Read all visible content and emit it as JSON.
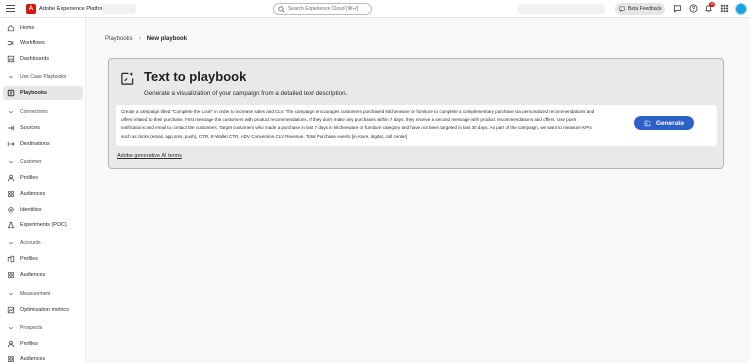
{
  "app": {
    "title": "Adobe Experience Platform",
    "logo_letter": "A"
  },
  "search": {
    "placeholder": "Search Experience Cloud [⌘+/]"
  },
  "header": {
    "beta_feedback": "Beta Feedback",
    "notification_count": "10"
  },
  "sidebar": {
    "home": "Home",
    "workflows": "Workflows",
    "dashboards": "Dashboards",
    "use_case_playbooks": "Use Case Playbooks",
    "playbooks": "Playbooks",
    "connections": "Connections",
    "sources": "Sources",
    "destinations": "Destinations",
    "customer": "Customer",
    "customer_profiles": "Profiles",
    "customer_audiences": "Audiences",
    "identities": "Identities",
    "experiments": "Experiments (POC)",
    "accounts": "Accounts",
    "accounts_profiles": "Profiles",
    "accounts_audiences": "Audiences",
    "measurement": "Measurement",
    "optimization_metrics": "Optimization metrics",
    "prospects": "Prospects",
    "prospects_profiles": "Profiles",
    "prospects_audiences": "Audiences"
  },
  "breadcrumb": {
    "parent": "Playbooks",
    "separator": "›",
    "current": "New playbook"
  },
  "panel": {
    "title": "Text to playbook",
    "subtitle": "Generate a visualization of your campaign from a detailed text description.",
    "prompt_text": "Create a campaign titled \"Complete the Look\" in order to increase sales and CLV. The campaign encourages customers purchased kitchenware or furniture to complete a complementary purchase via personalized recommendations and offers related to their purchase. First message the customers with product recommendations. If they don't make any purchases within 7 days, they receive a second message with product recommendations and offers. Use push notifications and email to contact the customers. Target customers who made a purchase in last 7 days in kitchenware or furniture category and have not been targeted in last 30 days. As part of the campaign, we want to measure KPIs such as clicks (email, app,sms, push), CTR, E-Wallet CTR, ADV Conversion,CLV Revenue, Total Purchase events [in-store, digital, call center]",
    "generate_label": "Generate",
    "terms_link": "Adobe generative AI terms"
  },
  "colors": {
    "accent": "#2d5fc8",
    "logo": "#d7170b",
    "badge": "#d31510",
    "avatar": "#1aa1e0"
  }
}
